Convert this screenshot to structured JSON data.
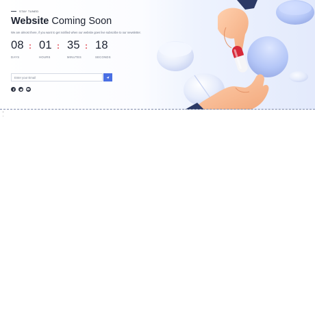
{
  "hero": {
    "eyebrow": "STAY TUNED",
    "title_bold": "Website",
    "title_rest": "Coming Soon",
    "subtitle": "We are almost there, if you want to get notified when our website goes live subscribe to our newsletter."
  },
  "countdown": {
    "separator": ":",
    "days": {
      "value": "08",
      "label": "DAYS"
    },
    "hours": {
      "value": "01",
      "label": "HOURS"
    },
    "minutes": {
      "value": "35",
      "label": "MINUTES"
    },
    "seconds": {
      "value": "18",
      "label": "SECONDS"
    }
  },
  "subscribe": {
    "placeholder": "Enter your Email",
    "button_icon": "send-icon"
  },
  "socials": [
    {
      "icon": "facebook-icon"
    },
    {
      "icon": "twitter-icon"
    },
    {
      "icon": "youtube-icon"
    }
  ],
  "colors": {
    "accent": "#4a6fe3",
    "separator": "#e0424d",
    "text": "#1c2230"
  }
}
